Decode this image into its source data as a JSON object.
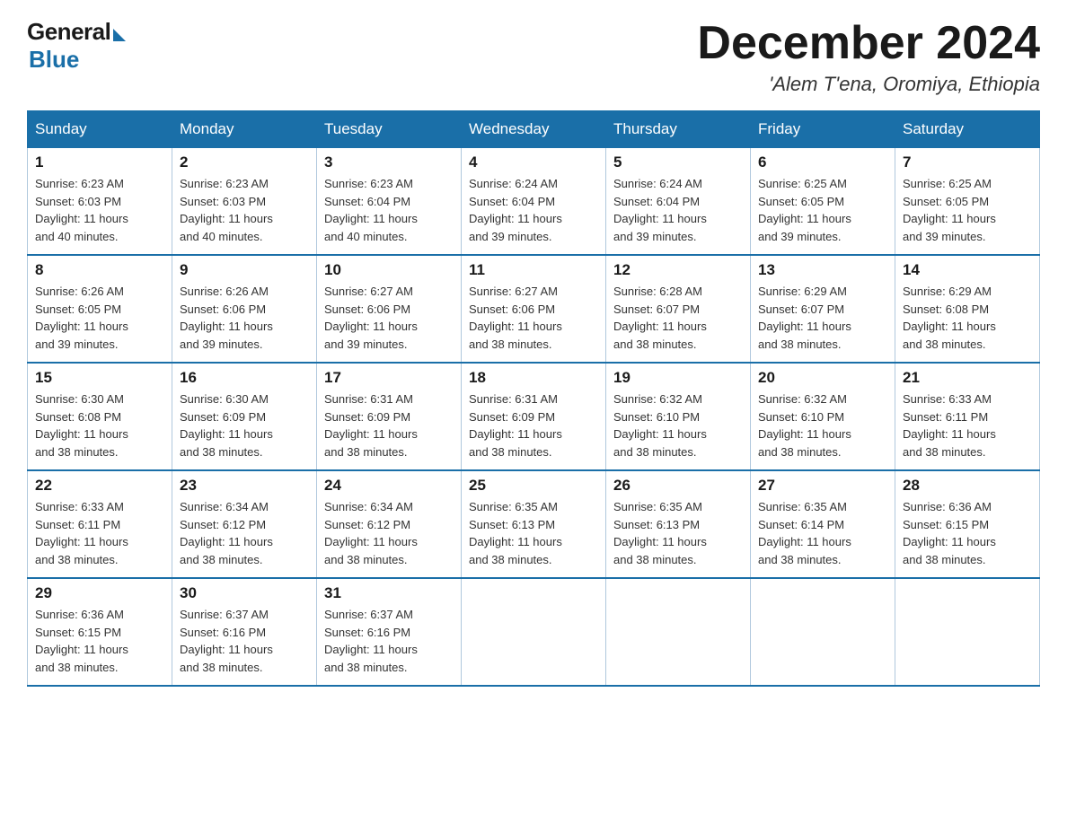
{
  "logo": {
    "general": "General",
    "blue": "Blue"
  },
  "title": "December 2024",
  "subtitle": "'Alem T'ena, Oromiya, Ethiopia",
  "days_of_week": [
    "Sunday",
    "Monday",
    "Tuesday",
    "Wednesday",
    "Thursday",
    "Friday",
    "Saturday"
  ],
  "weeks": [
    [
      {
        "day": "1",
        "sunrise": "6:23 AM",
        "sunset": "6:03 PM",
        "daylight": "11 hours and 40 minutes."
      },
      {
        "day": "2",
        "sunrise": "6:23 AM",
        "sunset": "6:03 PM",
        "daylight": "11 hours and 40 minutes."
      },
      {
        "day": "3",
        "sunrise": "6:23 AM",
        "sunset": "6:04 PM",
        "daylight": "11 hours and 40 minutes."
      },
      {
        "day": "4",
        "sunrise": "6:24 AM",
        "sunset": "6:04 PM",
        "daylight": "11 hours and 39 minutes."
      },
      {
        "day": "5",
        "sunrise": "6:24 AM",
        "sunset": "6:04 PM",
        "daylight": "11 hours and 39 minutes."
      },
      {
        "day": "6",
        "sunrise": "6:25 AM",
        "sunset": "6:05 PM",
        "daylight": "11 hours and 39 minutes."
      },
      {
        "day": "7",
        "sunrise": "6:25 AM",
        "sunset": "6:05 PM",
        "daylight": "11 hours and 39 minutes."
      }
    ],
    [
      {
        "day": "8",
        "sunrise": "6:26 AM",
        "sunset": "6:05 PM",
        "daylight": "11 hours and 39 minutes."
      },
      {
        "day": "9",
        "sunrise": "6:26 AM",
        "sunset": "6:06 PM",
        "daylight": "11 hours and 39 minutes."
      },
      {
        "day": "10",
        "sunrise": "6:27 AM",
        "sunset": "6:06 PM",
        "daylight": "11 hours and 39 minutes."
      },
      {
        "day": "11",
        "sunrise": "6:27 AM",
        "sunset": "6:06 PM",
        "daylight": "11 hours and 38 minutes."
      },
      {
        "day": "12",
        "sunrise": "6:28 AM",
        "sunset": "6:07 PM",
        "daylight": "11 hours and 38 minutes."
      },
      {
        "day": "13",
        "sunrise": "6:29 AM",
        "sunset": "6:07 PM",
        "daylight": "11 hours and 38 minutes."
      },
      {
        "day": "14",
        "sunrise": "6:29 AM",
        "sunset": "6:08 PM",
        "daylight": "11 hours and 38 minutes."
      }
    ],
    [
      {
        "day": "15",
        "sunrise": "6:30 AM",
        "sunset": "6:08 PM",
        "daylight": "11 hours and 38 minutes."
      },
      {
        "day": "16",
        "sunrise": "6:30 AM",
        "sunset": "6:09 PM",
        "daylight": "11 hours and 38 minutes."
      },
      {
        "day": "17",
        "sunrise": "6:31 AM",
        "sunset": "6:09 PM",
        "daylight": "11 hours and 38 minutes."
      },
      {
        "day": "18",
        "sunrise": "6:31 AM",
        "sunset": "6:09 PM",
        "daylight": "11 hours and 38 minutes."
      },
      {
        "day": "19",
        "sunrise": "6:32 AM",
        "sunset": "6:10 PM",
        "daylight": "11 hours and 38 minutes."
      },
      {
        "day": "20",
        "sunrise": "6:32 AM",
        "sunset": "6:10 PM",
        "daylight": "11 hours and 38 minutes."
      },
      {
        "day": "21",
        "sunrise": "6:33 AM",
        "sunset": "6:11 PM",
        "daylight": "11 hours and 38 minutes."
      }
    ],
    [
      {
        "day": "22",
        "sunrise": "6:33 AM",
        "sunset": "6:11 PM",
        "daylight": "11 hours and 38 minutes."
      },
      {
        "day": "23",
        "sunrise": "6:34 AM",
        "sunset": "6:12 PM",
        "daylight": "11 hours and 38 minutes."
      },
      {
        "day": "24",
        "sunrise": "6:34 AM",
        "sunset": "6:12 PM",
        "daylight": "11 hours and 38 minutes."
      },
      {
        "day": "25",
        "sunrise": "6:35 AM",
        "sunset": "6:13 PM",
        "daylight": "11 hours and 38 minutes."
      },
      {
        "day": "26",
        "sunrise": "6:35 AM",
        "sunset": "6:13 PM",
        "daylight": "11 hours and 38 minutes."
      },
      {
        "day": "27",
        "sunrise": "6:35 AM",
        "sunset": "6:14 PM",
        "daylight": "11 hours and 38 minutes."
      },
      {
        "day": "28",
        "sunrise": "6:36 AM",
        "sunset": "6:15 PM",
        "daylight": "11 hours and 38 minutes."
      }
    ],
    [
      {
        "day": "29",
        "sunrise": "6:36 AM",
        "sunset": "6:15 PM",
        "daylight": "11 hours and 38 minutes."
      },
      {
        "day": "30",
        "sunrise": "6:37 AM",
        "sunset": "6:16 PM",
        "daylight": "11 hours and 38 minutes."
      },
      {
        "day": "31",
        "sunrise": "6:37 AM",
        "sunset": "6:16 PM",
        "daylight": "11 hours and 38 minutes."
      },
      null,
      null,
      null,
      null
    ]
  ],
  "labels": {
    "sunrise": "Sunrise: ",
    "sunset": "Sunset: ",
    "daylight": "Daylight: "
  }
}
